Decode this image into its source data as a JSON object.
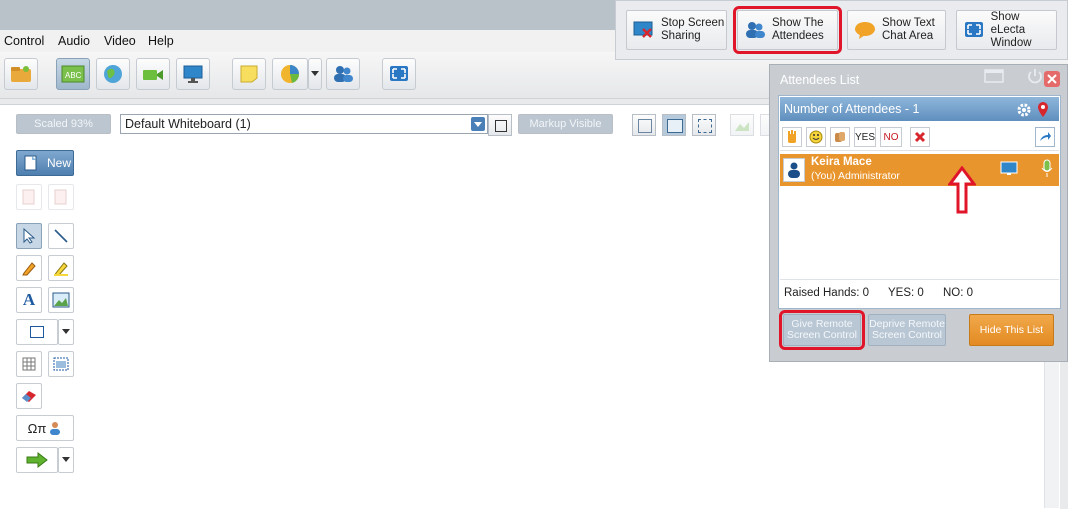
{
  "menu": [
    "Control",
    "Audio",
    "Video",
    "Help"
  ],
  "ribbon": {
    "stop_screen_sharing": "Stop Screen\nSharing",
    "show_attendees": "Show The\nAttendees",
    "show_text_chat": "Show Text\nChat Area",
    "show_electa": "Show eLecta\nWindow"
  },
  "whiteboard": {
    "scaled": "Scaled 93%",
    "selected": "Default Whiteboard (1)",
    "markup": "Markup Visible",
    "new_label": "New",
    "omega_pi": "Ωπ"
  },
  "attendees": {
    "panel_title": "Attendees List",
    "count_label": "Number of Attendees - 1",
    "yes_label": "YES",
    "no_label": "NO",
    "user_name": "Keira Mace",
    "user_role": "(You) Administrator",
    "raised_hands": "Raised Hands:  0",
    "yes_count": "YES:  0",
    "no_count": "NO:  0",
    "give_remote": "Give Remote\nScreen Control",
    "deprive_remote": "Deprive Remote\nScreen Control",
    "hide_list": "Hide This List"
  },
  "colors": {
    "accent_orange": "#e9952e",
    "header_blue": "#5f8fbe",
    "highlight_red": "#e0152a"
  }
}
